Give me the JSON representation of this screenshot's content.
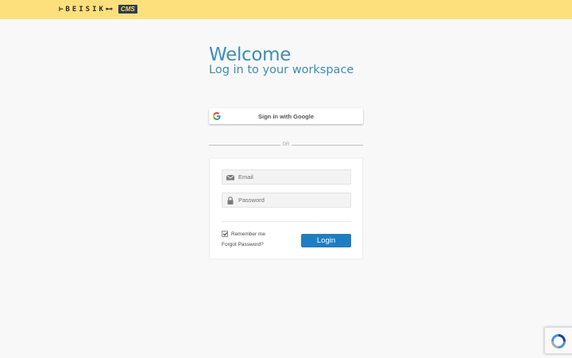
{
  "header": {
    "logo_text": "⊢BEISIK⊷",
    "logo_badge": "CMS",
    "background_color": "#fde07c"
  },
  "main": {
    "title": "Welcome",
    "subtitle": "Log in to your workspace"
  },
  "google": {
    "label": "Sign in with Google",
    "icon": "google-g-icon"
  },
  "divider": {
    "label": "OR"
  },
  "form": {
    "email": {
      "placeholder": "Email",
      "value": "",
      "icon": "envelope-icon"
    },
    "password": {
      "placeholder": "Password",
      "value": "",
      "icon": "lock-icon"
    },
    "remember": {
      "label": "Remember me",
      "checked": true
    },
    "forgot_label": "Forgot Password?",
    "login_label": "Login"
  },
  "recaptcha": {
    "icon": "recaptcha-icon"
  },
  "colors": {
    "accent": "#3a8fb7",
    "button": "#1f7ec1",
    "page_background": "#f8f8f8"
  }
}
